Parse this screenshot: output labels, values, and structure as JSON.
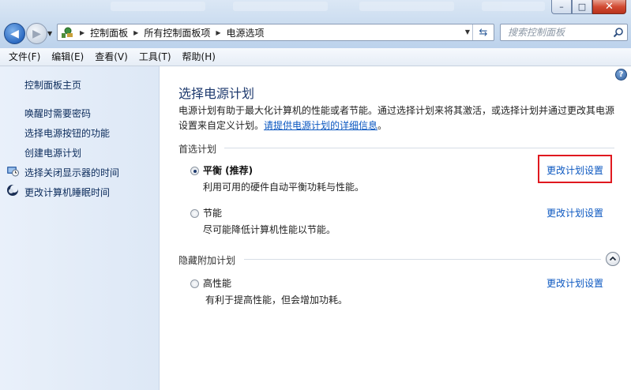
{
  "window": {
    "minimize_label": "–",
    "maximize_label": "□",
    "close_label": "✕"
  },
  "address": {
    "crumbs": [
      "控制面板",
      "所有控制面板项",
      "电源选项"
    ]
  },
  "search": {
    "placeholder": "搜索控制面板"
  },
  "menu": {
    "items": [
      "文件(F)",
      "编辑(E)",
      "查看(V)",
      "工具(T)",
      "帮助(H)"
    ]
  },
  "sidebar": {
    "home": "控制面板主页",
    "links": [
      "唤醒时需要密码",
      "选择电源按钮的功能",
      "创建电源计划",
      "选择关闭显示器的时间",
      "更改计算机睡眠时间"
    ]
  },
  "main": {
    "title": "选择电源计划",
    "description": "电源计划有助于最大化计算机的性能或者节能。通过选择计划来将其激活，或选择计划并通过更改其电源设置来自定义计划。",
    "description_link": "请提供电源计划的详细信息",
    "description_end": "。",
    "preferred_label": "首选计划",
    "hidden_label": "隐藏附加计划",
    "plans": [
      {
        "name": "平衡 (推荐)",
        "desc": "利用可用的硬件自动平衡功耗与性能。",
        "link": "更改计划设置",
        "selected": true
      },
      {
        "name": "节能",
        "desc": "尽可能降低计算机性能以节能。",
        "link": "更改计划设置",
        "selected": false
      },
      {
        "name": "高性能",
        "desc": "有利于提高性能，但会增加功耗。",
        "link": "更改计划设置",
        "selected": false
      }
    ]
  },
  "colors": {
    "link": "#0b57c0",
    "highlight": "#e0191f",
    "title": "#1e3a6e"
  }
}
